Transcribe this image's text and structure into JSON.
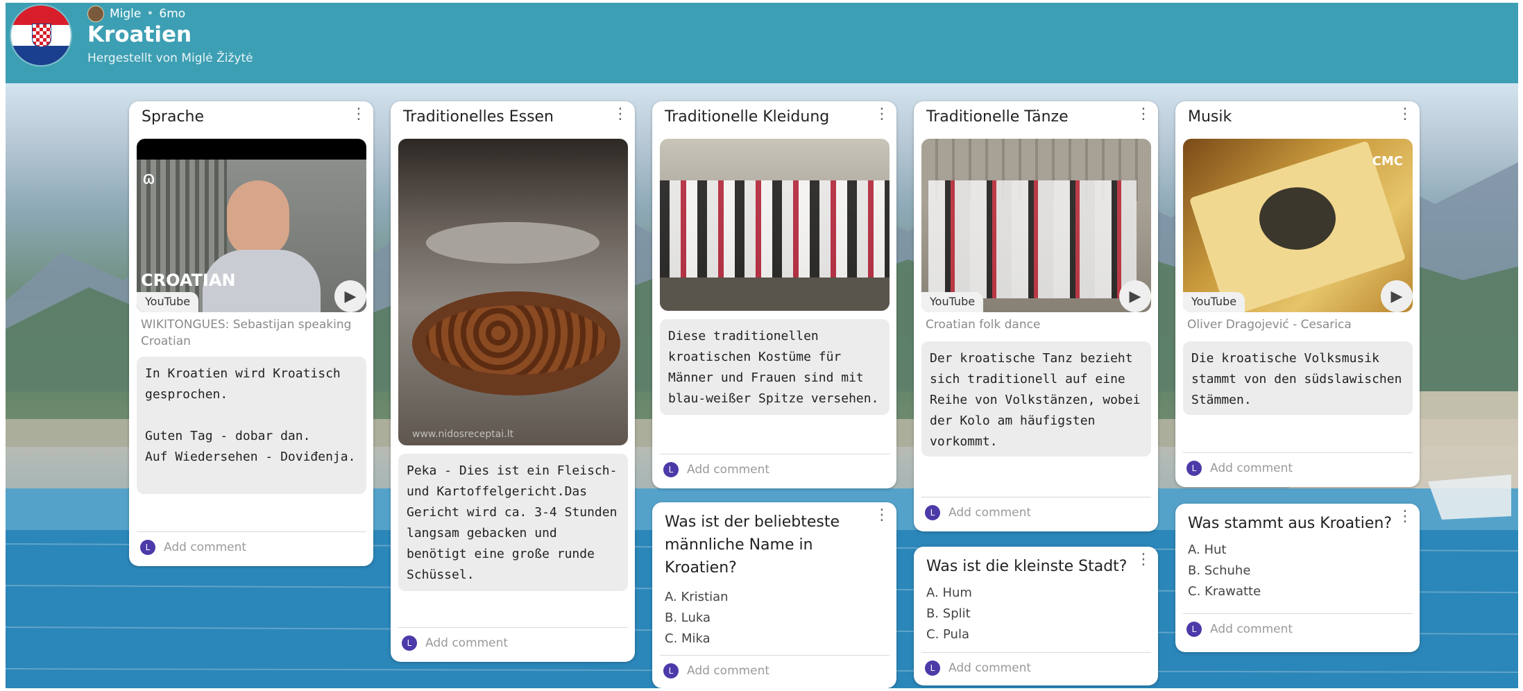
{
  "header": {
    "author": "Migle",
    "age": "6mo",
    "title": "Kroatien",
    "subtitle": "Hergestellt von Miglė Žižytė"
  },
  "icons": {
    "more": "kebab-vertical-icon",
    "play": "play-icon",
    "comment_avatar": "L"
  },
  "colors": {
    "header": "#3d9fb3",
    "comment_avatar": "#4b3aa8"
  },
  "columns": [
    {
      "card": {
        "title": "Sprache",
        "yt": "YouTube",
        "media_overlay": "CROATIAN",
        "caption": "WIKITONGUES: Sebastijan speaking Croatian",
        "text": "In Kroatien wird Kroatisch gesprochen.\n\nGuten Tag - dobar dan.\nAuf Wiedersehen - Doviđenja.",
        "comment": "Add comment"
      }
    },
    {
      "card": {
        "title": "Traditionelles Essen",
        "media_overlay": "www.nidosreceptai.lt",
        "text": "Peka - Dies ist ein Fleisch- und Kartoffelgericht.Das Gericht wird ca. 3-4 Stunden langsam gebacken und benötigt eine große runde Schüssel.",
        "comment": "Add comment"
      }
    },
    {
      "card": {
        "title": "Traditionelle Kleidung",
        "text": "Diese traditionellen kroatischen Kostüme für Männer und Frauen sind mit blau-weißer Spitze versehen.",
        "comment": "Add comment"
      },
      "quiz": {
        "title": "Was ist der beliebteste männliche Name in Kroatien?",
        "answers": [
          "A. Kristian",
          "B. Luka",
          "C. Mika"
        ],
        "comment": "Add comment"
      }
    },
    {
      "card": {
        "title": "Traditionelle Tänze",
        "yt": "YouTube",
        "caption": "Croatian folk dance",
        "text": "Der kroatische Tanz bezieht sich traditionell auf eine Reihe von Volkstänzen, wobei der Kolo am häufigsten vorkommt.",
        "comment": "Add comment"
      },
      "quiz": {
        "title": "Was ist die kleinste Stadt?",
        "answers": [
          "A. Hum",
          "B. Split",
          "C. Pula"
        ],
        "comment": "Add comment"
      }
    },
    {
      "card": {
        "title": "Musik",
        "yt": "YouTube",
        "media_overlay": "CMC",
        "caption": "Oliver Dragojević - Cesarica",
        "text": "Die kroatische Volksmusik stammt von den südslawischen Stämmen.",
        "comment": "Add comment"
      },
      "quiz": {
        "title": "Was stammt aus Kroatien?",
        "answers": [
          "A. Hut",
          "B. Schuhe",
          "C. Krawatte"
        ],
        "comment": "Add comment"
      }
    }
  ]
}
